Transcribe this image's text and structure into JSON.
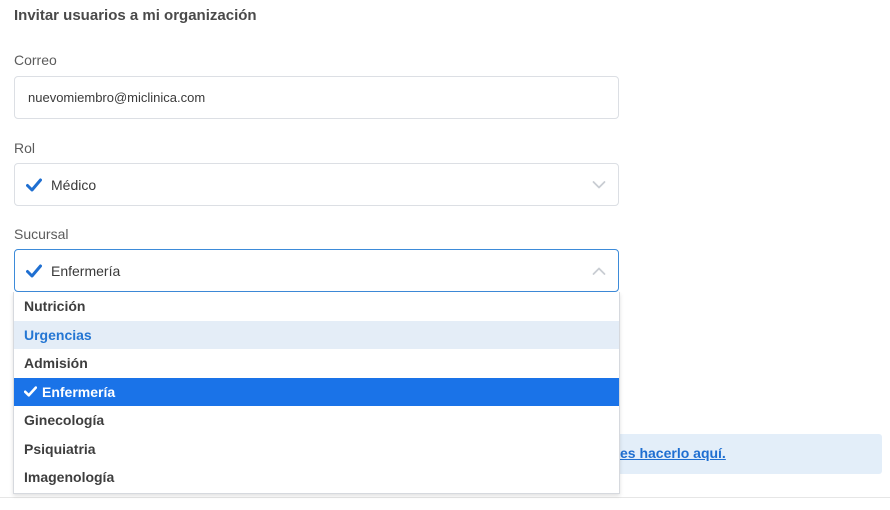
{
  "title": "Invitar usuarios a mi organización",
  "email": {
    "label": "Correo",
    "value": "nuevomiembro@miclinica.com"
  },
  "role": {
    "label": "Rol",
    "selected": "Médico"
  },
  "branch": {
    "label": "Sucursal",
    "selected": "Enfermería",
    "options": [
      "Nutrición",
      "Urgencias",
      "Admisión",
      "Enfermería",
      "Ginecología",
      "Psiquiatria",
      "Imagenología"
    ],
    "hovered": "Urgencias"
  },
  "banner": {
    "link_text": "es hacerlo aquí."
  },
  "colors": {
    "accent": "#1a73e8",
    "hover_bg": "#e4edf7",
    "banner_bg": "#e3eef9",
    "check": "#1f6fd1"
  }
}
